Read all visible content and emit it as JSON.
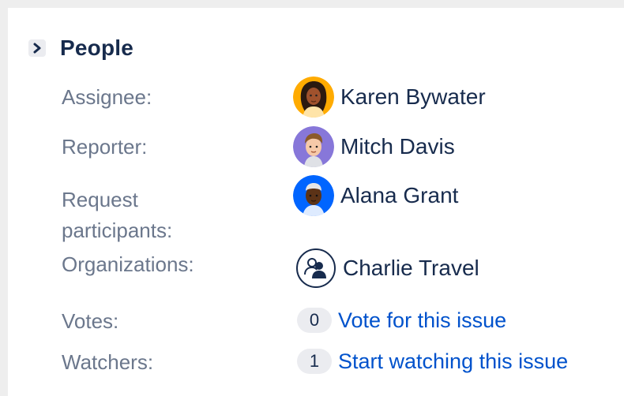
{
  "section": {
    "title": "People",
    "chevron_icon": "chevron-right-icon"
  },
  "fields": {
    "assignee": {
      "label": "Assignee:",
      "name": "Karen Bywater",
      "avatar_icon": "avatar-karen-icon"
    },
    "reporter": {
      "label": "Reporter:",
      "name": "Mitch Davis",
      "avatar_icon": "avatar-mitch-icon"
    },
    "participants": {
      "label_line1": "Request",
      "label_line2": "participants:",
      "name": "Alana Grant",
      "avatar_icon": "avatar-alana-icon"
    },
    "organizations": {
      "label": "Organizations:",
      "name": "Charlie Travel",
      "icon": "organization-icon"
    },
    "votes": {
      "label": "Votes:",
      "count": "0",
      "action": "Vote for this issue"
    },
    "watchers": {
      "label": "Watchers:",
      "count": "1",
      "action": "Start watching this issue"
    }
  },
  "colors": {
    "link": "#0052cc",
    "label": "#6b778c",
    "text": "#172b4d",
    "pill": "#ebecf0"
  }
}
